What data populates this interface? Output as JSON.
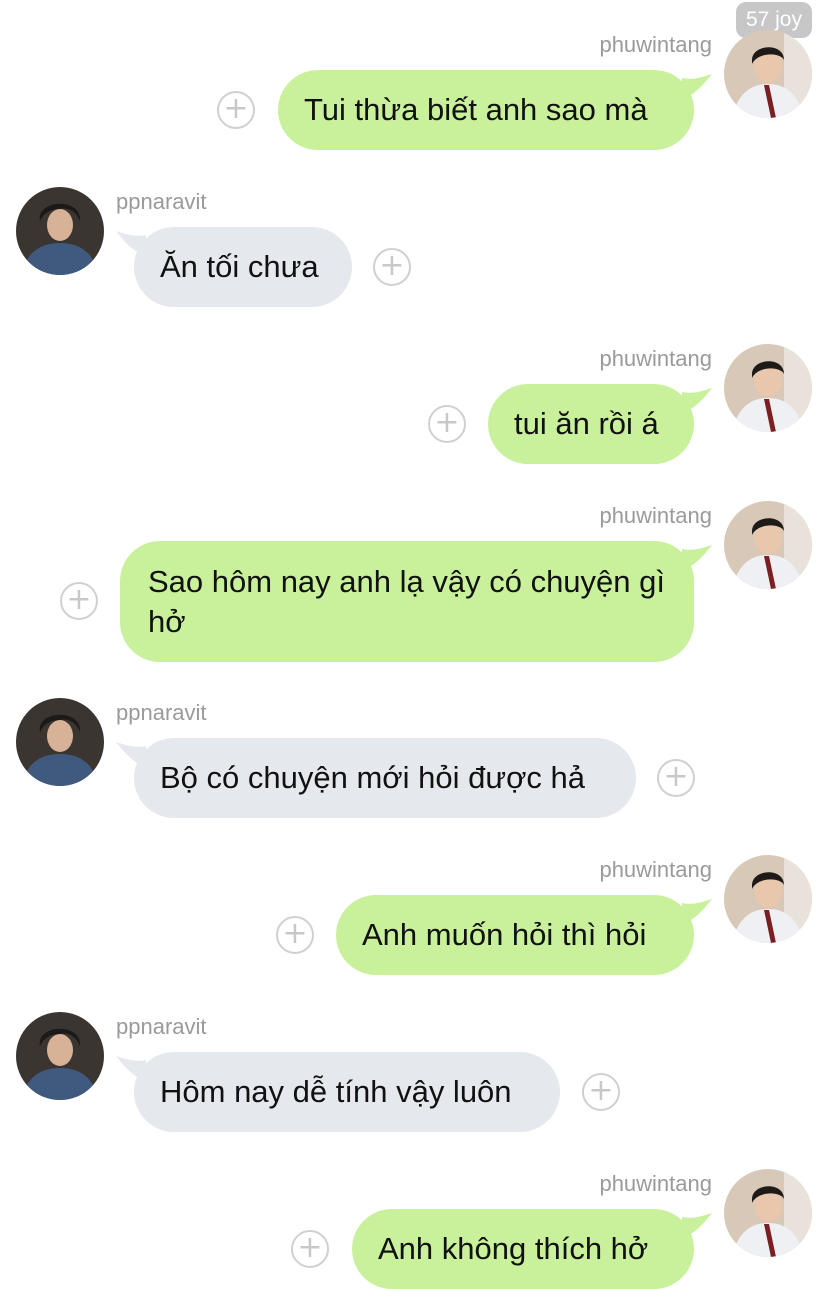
{
  "watermark": "57 joy",
  "messages": [
    {
      "side": "right",
      "user": "phuwintang",
      "text": "Tui thừa biết anh sao mà"
    },
    {
      "side": "left",
      "user": "ppnaravit",
      "text": "Ăn tối chưa"
    },
    {
      "side": "right",
      "user": "phuwintang",
      "text": "tui ăn rồi á"
    },
    {
      "side": "right",
      "user": "phuwintang",
      "text": "Sao hôm nay anh lạ vậy có chuyện gì hở"
    },
    {
      "side": "left",
      "user": "ppnaravit",
      "text": "Bộ có chuyện mới hỏi được hả"
    },
    {
      "side": "right",
      "user": "phuwintang",
      "text": "Anh muốn hỏi thì hỏi"
    },
    {
      "side": "left",
      "user": "ppnaravit",
      "text": "Hôm nay dễ tính vậy luôn"
    },
    {
      "side": "right",
      "user": "phuwintang",
      "text": "Anh không thích hở"
    }
  ],
  "add_reaction_glyph": "+",
  "colors": {
    "sent_bubble": "#c9f09b",
    "received_bubble": "#e5e8ec",
    "username": "#9a9a9a"
  },
  "icons": {
    "add_reaction": "plus-circle-icon",
    "avatar_sent": "avatar-phuwintang",
    "avatar_received": "avatar-ppnaravit"
  }
}
